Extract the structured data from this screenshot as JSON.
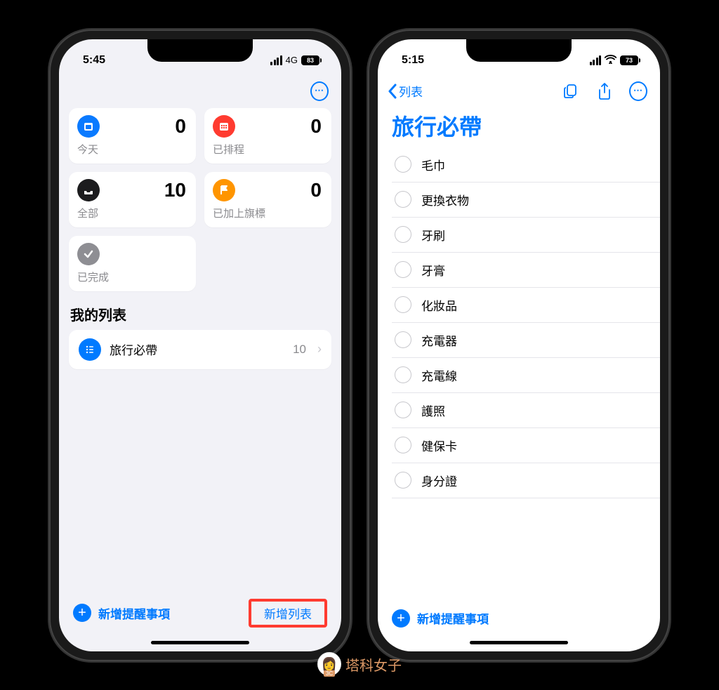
{
  "left": {
    "status": {
      "time": "5:45",
      "network": "4G",
      "battery": "83"
    },
    "cards": [
      {
        "label": "今天",
        "count": "0",
        "icon": "calendar",
        "color": "ic-blue"
      },
      {
        "label": "已排程",
        "count": "0",
        "icon": "calendar-grid",
        "color": "ic-red"
      },
      {
        "label": "全部",
        "count": "10",
        "icon": "tray",
        "color": "ic-black"
      },
      {
        "label": "已加上旗標",
        "count": "0",
        "icon": "flag",
        "color": "ic-orange"
      },
      {
        "label": "已完成",
        "count": "",
        "icon": "check",
        "color": "ic-gray"
      }
    ],
    "sectionTitle": "我的列表",
    "list": {
      "name": "旅行必帶",
      "count": "10"
    },
    "addReminder": "新增提醒事項",
    "addList": "新增列表"
  },
  "right": {
    "status": {
      "time": "5:15",
      "battery": "73"
    },
    "back": "列表",
    "title": "旅行必帶",
    "items": [
      "毛巾",
      "更換衣物",
      "牙刷",
      "牙膏",
      "化妝品",
      "充電器",
      "充電線",
      "護照",
      "健保卡",
      "身分證"
    ],
    "addReminder": "新增提醒事項"
  },
  "watermark": "塔科女子"
}
